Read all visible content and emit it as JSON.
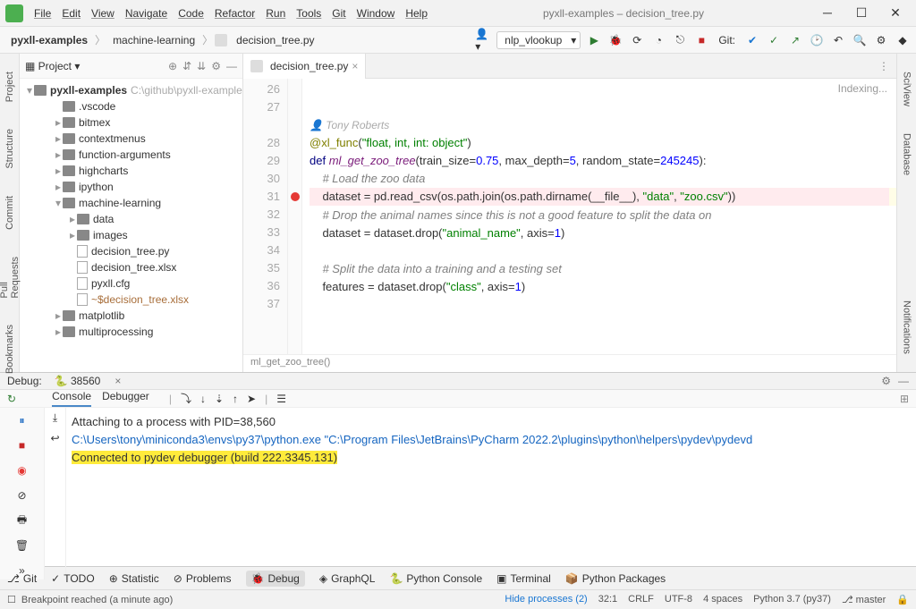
{
  "window": {
    "title": "pyxll-examples – decision_tree.py"
  },
  "menu": [
    "File",
    "Edit",
    "View",
    "Navigate",
    "Code",
    "Refactor",
    "Run",
    "Tools",
    "Git",
    "Window",
    "Help"
  ],
  "breadcrumbs": {
    "root": "pyxll-examples",
    "folder": "machine-learning",
    "file": "decision_tree.py"
  },
  "run_config": {
    "selected": "nlp_vlookup"
  },
  "toolbar": {
    "git_label": "Git:"
  },
  "project": {
    "title": "Project",
    "root": {
      "name": "pyxll-examples",
      "path": "C:\\github\\pyxll-example"
    },
    "items": [
      {
        "name": ".vscode",
        "type": "folder",
        "level": 2,
        "expanded": false
      },
      {
        "name": "bitmex",
        "type": "folder",
        "level": 2,
        "expanded": false,
        "chev": true
      },
      {
        "name": "contextmenus",
        "type": "folder",
        "level": 2,
        "expanded": false,
        "chev": true
      },
      {
        "name": "function-arguments",
        "type": "folder",
        "level": 2,
        "expanded": false,
        "chev": true
      },
      {
        "name": "highcharts",
        "type": "folder",
        "level": 2,
        "expanded": false,
        "chev": true
      },
      {
        "name": "ipython",
        "type": "folder",
        "level": 2,
        "expanded": false,
        "chev": true
      },
      {
        "name": "machine-learning",
        "type": "folder",
        "level": 2,
        "expanded": true,
        "chev": true
      },
      {
        "name": "data",
        "type": "folder",
        "level": 3,
        "expanded": false,
        "chev": true
      },
      {
        "name": "images",
        "type": "folder",
        "level": 3,
        "expanded": false,
        "chev": true
      },
      {
        "name": "decision_tree.py",
        "type": "file",
        "level": 3
      },
      {
        "name": "decision_tree.xlsx",
        "type": "file",
        "level": 3
      },
      {
        "name": "pyxll.cfg",
        "type": "file",
        "level": 3
      },
      {
        "name": "~$decision_tree.xlsx",
        "type": "file",
        "level": 3,
        "color": "#a86e3a"
      },
      {
        "name": "matplotlib",
        "type": "folder",
        "level": 2,
        "expanded": false,
        "chev": true
      },
      {
        "name": "multiprocessing",
        "type": "folder",
        "level": 2,
        "expanded": false,
        "chev": true
      }
    ]
  },
  "editor": {
    "tab": "decision_tree.py",
    "indexing": "Indexing...",
    "crumb": "ml_get_zoo_tree()",
    "author": "Tony Roberts",
    "lines": [
      {
        "n": 26,
        "html": ""
      },
      {
        "n": 27,
        "html": ""
      },
      {
        "n": "",
        "author": true
      },
      {
        "n": 28,
        "html": "<span class='dec'>@xl_func</span>(<span class='str'>\"float, int, int: object\"</span>)"
      },
      {
        "n": 29,
        "html": "<span class='kw'>def</span> <span class='id'>ml_get_zoo_tree</span>(train_size=<span class='num'>0.75</span>, max_depth=<span class='num'>5</span>, random_state=<span class='num'>245245</span>):"
      },
      {
        "n": 30,
        "html": "    <span class='cmt'># Load the zoo data</span>"
      },
      {
        "n": 31,
        "bp": true,
        "hl": true,
        "html": "    dataset = pd.read_csv(os.path.join(os.path.dirname(__file__), <span class='str'>\"data\"</span>, <span class='str'>\"zoo.csv\"</span>))"
      },
      {
        "n": 32,
        "caret": true,
        "html": "    "
      },
      {
        "n": 33,
        "html": "    <span class='cmt'># Drop the animal names since this is not a good feature to split the data on</span>"
      },
      {
        "n": 34,
        "html": "    dataset = dataset.drop(<span class='str'>\"animal_name\"</span>, axis=<span class='num'>1</span>)"
      },
      {
        "n": 35,
        "html": ""
      },
      {
        "n": 36,
        "html": "    <span class='cmt'># Split the data into a training and a testing set</span>"
      },
      {
        "n": 37,
        "html": "    features = dataset.drop(<span class='str'>\"class\"</span>, axis=<span class='num'>1</span>)"
      }
    ]
  },
  "debug": {
    "title": "Debug:",
    "session": "38560",
    "tabs": {
      "console": "Console",
      "debugger": "Debugger"
    },
    "console_lines": {
      "l1": "Attaching to a process with PID=38,560",
      "l2": "C:\\Users\\tony\\miniconda3\\envs\\py37\\python.exe \"C:\\Program Files\\JetBrains\\PyCharm 2022.2\\plugins\\python\\helpers\\pydev\\pydevd",
      "l3": "Connected to pydev debugger (build 222.3345.131)"
    }
  },
  "bottom_tabs": {
    "git": "Git",
    "todo": "TODO",
    "statistic": "Statistic",
    "problems": "Problems",
    "debug": "Debug",
    "graphql": "GraphQL",
    "python_console": "Python Console",
    "terminal": "Terminal",
    "python_packages": "Python Packages"
  },
  "statusbar": {
    "msg": "Breakpoint reached (a minute ago)",
    "hide": "Hide processes (2)",
    "pos": "32:1",
    "eol": "CRLF",
    "enc": "UTF-8",
    "indent": "4 spaces",
    "interp": "Python 3.7 (py37)",
    "branch": "master"
  },
  "side_tabs": {
    "left": [
      "Project",
      "Structure",
      "Commit",
      "Pull Requests",
      "Bookmarks"
    ],
    "right": [
      "SciView",
      "Database",
      "Notifications"
    ]
  }
}
